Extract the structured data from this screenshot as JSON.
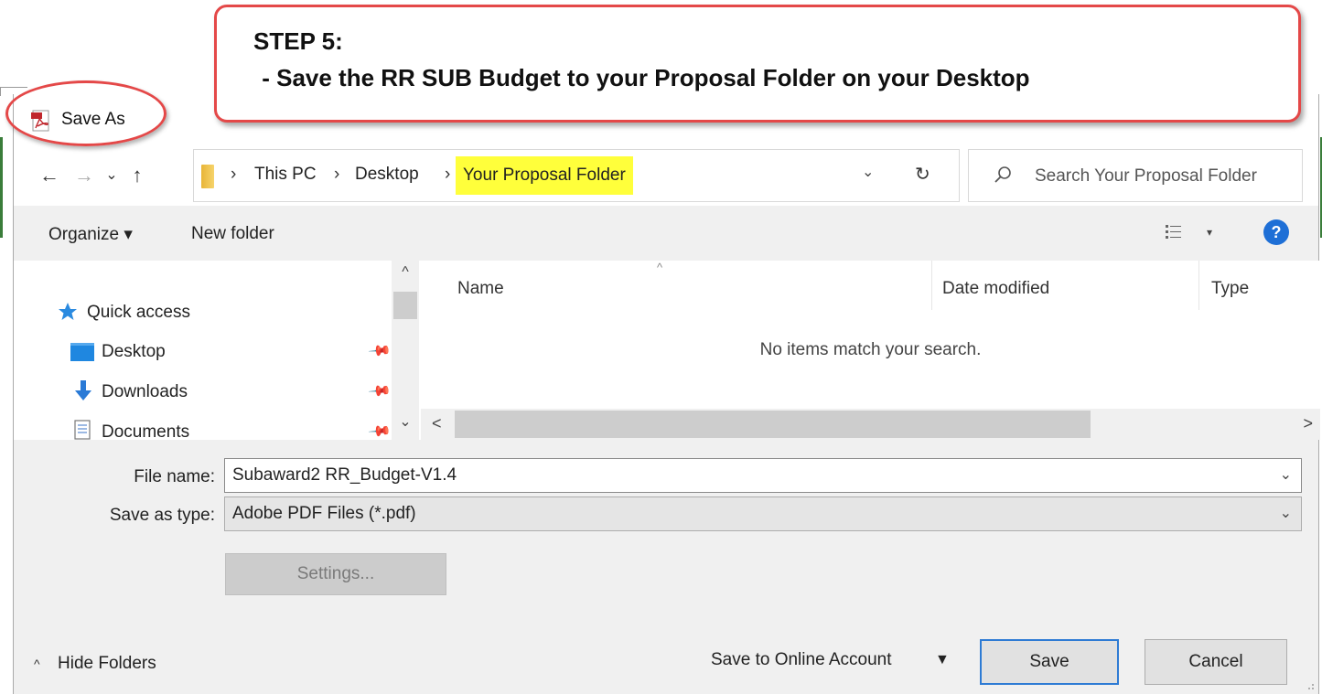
{
  "callout": {
    "line1": "STEP 5:",
    "line2": " - Save the RR SUB Budget to your Proposal Folder on your Desktop",
    "border_color": "#e44848"
  },
  "window": {
    "title": "Save As",
    "icon": "pdf-icon"
  },
  "address_bar": {
    "back_icon": "←",
    "forward_icon": "→",
    "recent_icon": "⌄",
    "up_icon": "↑",
    "separator": "›",
    "crumbs": [
      "This PC",
      "Desktop",
      "Your Proposal Folder"
    ],
    "highlight_color": "#ffff3b",
    "dropdown_icon": "⌄",
    "refresh_icon": "↻"
  },
  "search": {
    "placeholder": "Search Your Proposal Folder"
  },
  "toolbar": {
    "organize_label": "Organize ▾",
    "new_folder_label": "New folder",
    "view_arrow": "▾",
    "help_label": "?"
  },
  "nav_pane": {
    "items": [
      {
        "label": "Quick access",
        "icon": "star-icon"
      },
      {
        "label": "Desktop",
        "icon": "desktop-icon",
        "pin": "📌"
      },
      {
        "label": "Downloads",
        "icon": "download-icon",
        "pin": "📌"
      },
      {
        "label": "Documents",
        "icon": "documents-icon",
        "pin": "📌"
      }
    ],
    "scroll_up": "^",
    "scroll_down": "⌄"
  },
  "file_list": {
    "sort_caret": "^",
    "columns": [
      "Name",
      "Date modified",
      "Type"
    ],
    "empty_message": "No items match your search.",
    "scroll_left": "<",
    "scroll_right": ">"
  },
  "form": {
    "file_name_label": "File name:",
    "file_name_value": "Subaward2 RR_Budget-V1.4",
    "save_as_type_label": "Save as type:",
    "save_as_type_value": "Adobe PDF Files (*.pdf)",
    "chevron": "⌄",
    "settings_label": "Settings..."
  },
  "footer": {
    "hide_folders_caret": "^",
    "hide_folders_label": "Hide Folders",
    "online_account_label": "Save to Online Account",
    "online_account_caret": "▼",
    "save_label": "Save",
    "cancel_label": "Cancel",
    "accent_color": "#2e7bd4"
  }
}
